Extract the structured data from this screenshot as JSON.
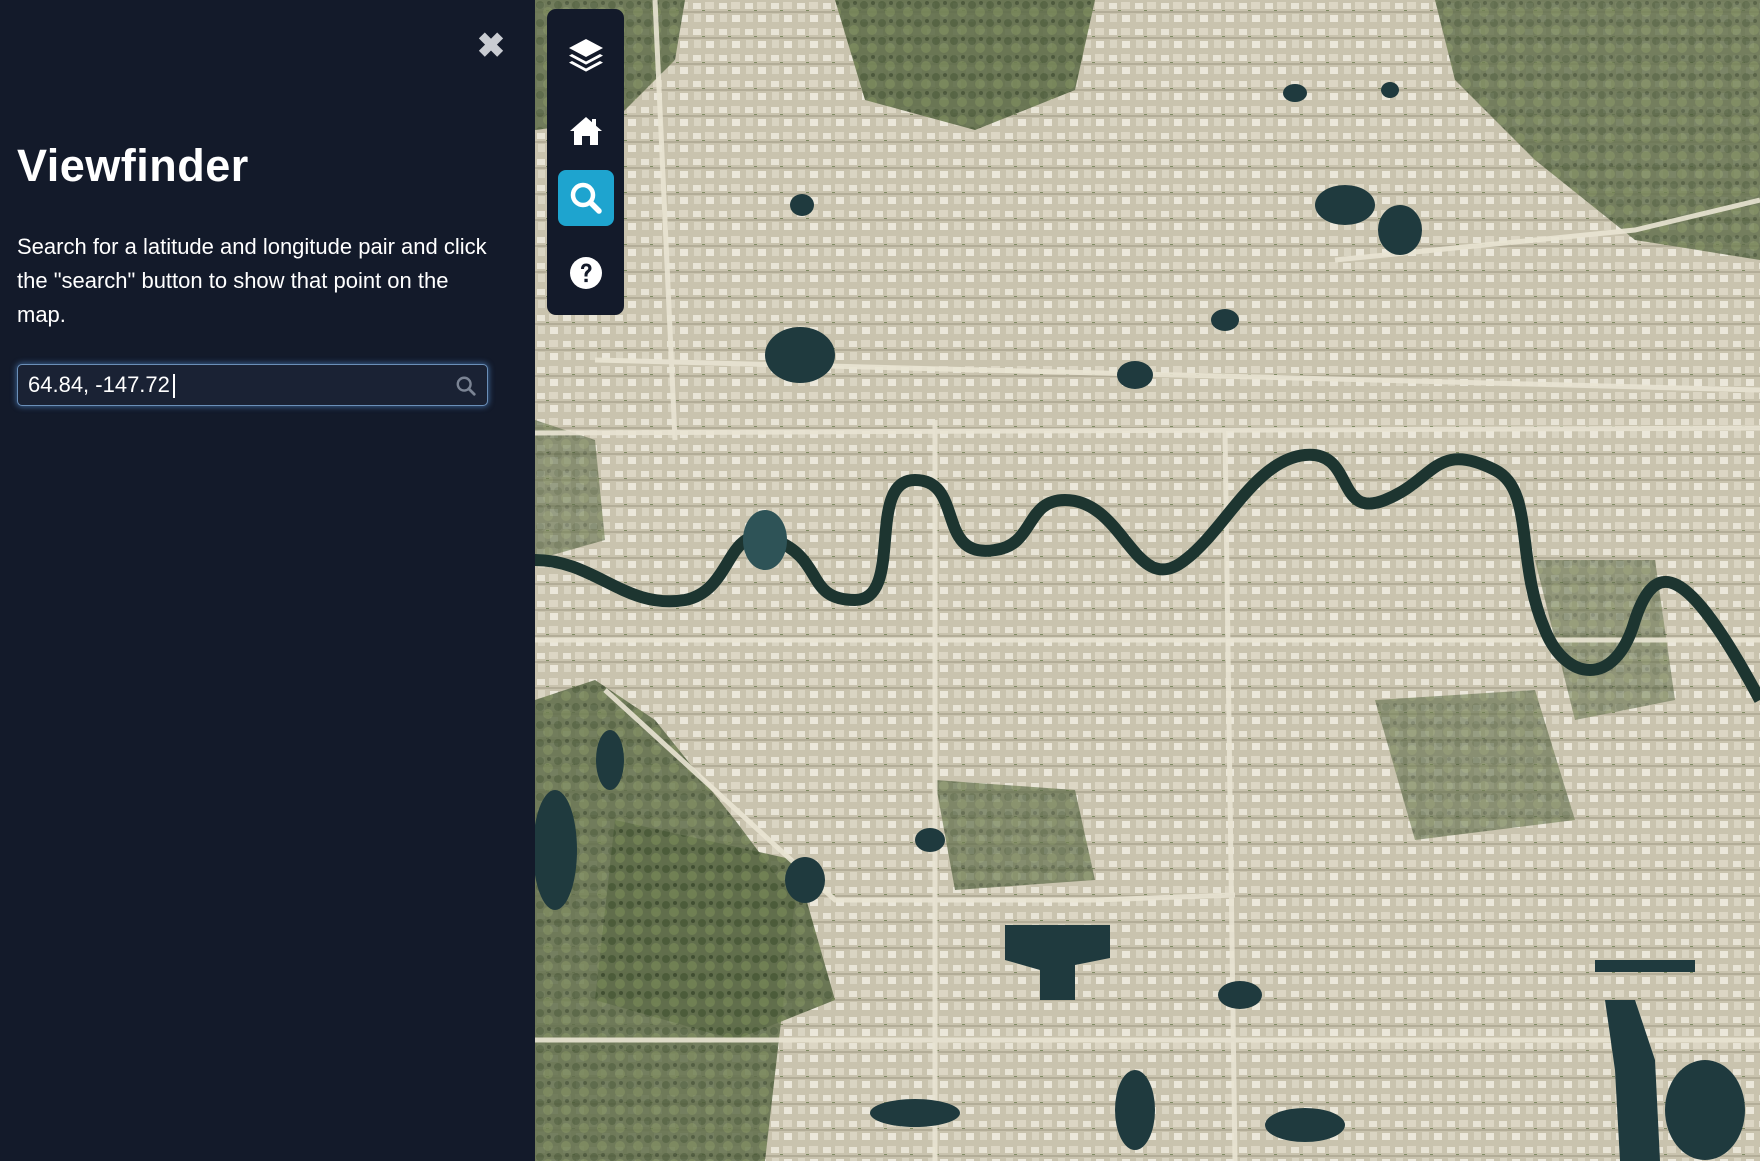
{
  "sidebar": {
    "title": "Viewfinder",
    "description": "Search for a latitude and longitude pair and click the \"search\" button to show that point on the map.",
    "search": {
      "value": "64.84, -147.72",
      "placeholder": ""
    },
    "close_icon": "close-icon"
  },
  "toolbar": {
    "buttons": [
      {
        "icon": "layers-icon",
        "active": false
      },
      {
        "icon": "home-icon",
        "active": false
      },
      {
        "icon": "search-icon",
        "active": true
      },
      {
        "icon": "help-icon",
        "active": false
      }
    ]
  },
  "map": {
    "type": "satellite imagery"
  },
  "colors": {
    "panel_bg": "#131a2a",
    "accent": "#1ea4cf",
    "text": "#ffffff",
    "input_border": "#6b8fb8"
  }
}
